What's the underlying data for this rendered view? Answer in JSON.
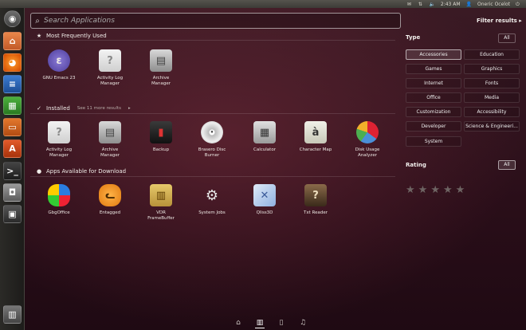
{
  "top_panel": {
    "time": "2:43 AM",
    "user": "Oneric Ocelot"
  },
  "search": {
    "placeholder": "Search Applications"
  },
  "filter_results": "Filter results",
  "sections": {
    "frequent": {
      "title": "Most Frequently Used"
    },
    "installed": {
      "title": "Installed",
      "more": "See 11 more results"
    },
    "download": {
      "title": "Apps Available for Download"
    }
  },
  "apps_frequent": [
    {
      "name": "GNU Emacs 23"
    },
    {
      "name": "Activity Log\nManager"
    },
    {
      "name": "Archive\nManager"
    }
  ],
  "apps_installed": [
    {
      "name": "Activity Log\nManager"
    },
    {
      "name": "Archive\nManager"
    },
    {
      "name": "Backup"
    },
    {
      "name": "Brasero Disc\nBurner"
    },
    {
      "name": "Calculator"
    },
    {
      "name": "Character Map"
    },
    {
      "name": "Disk Usage\nAnalyzer"
    }
  ],
  "apps_download": [
    {
      "name": "GbgOffice"
    },
    {
      "name": "Entagged"
    },
    {
      "name": "VDR\nFrameBuffer"
    },
    {
      "name": "System Jobs"
    },
    {
      "name": "Qliss3D"
    },
    {
      "name": "Txt Reader"
    }
  ],
  "filters": {
    "type_title": "Type",
    "all_label": "All",
    "categories": [
      "Accessories",
      "Education",
      "Games",
      "Graphics",
      "Internet",
      "Fonts",
      "Office",
      "Media",
      "Customization",
      "Accessibility",
      "Developer",
      "Science & Engineeri...",
      "System"
    ],
    "active_category": "Accessories",
    "rating_title": "Rating",
    "rating_all_label": "All",
    "rating_stars": 5
  },
  "colors": {
    "dash_bg": "#2a0f1c",
    "launcher_bg": "#2b2a27"
  }
}
